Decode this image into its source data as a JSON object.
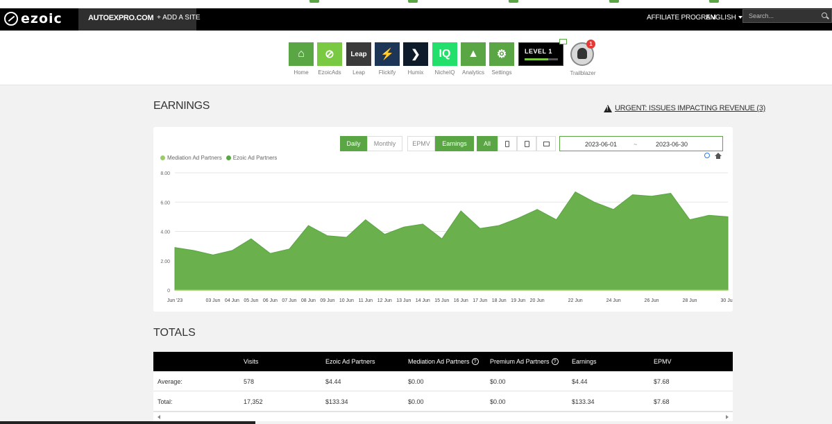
{
  "nav": {
    "site_name": "AUTOEXPRO.COM",
    "add_site": "+ ADD A SITE",
    "affiliate": "AFFILIATE PROGRAM",
    "language": "ENGLISH",
    "search_placeholder": "Search..."
  },
  "apps": [
    {
      "label": "Home",
      "glyph": "⌂",
      "color": "#5aa644"
    },
    {
      "label": "EzoicAds",
      "glyph": "⊘",
      "color": "#7ac943"
    },
    {
      "label": "Leap",
      "glyph": "Leap",
      "color": "#3a3a3a"
    },
    {
      "label": "Flickify",
      "glyph": "⚡",
      "color": "#1d3557"
    },
    {
      "label": "Humix",
      "glyph": "❯",
      "color": "#0d1b2a"
    },
    {
      "label": "NicheIQ",
      "glyph": "IQ",
      "color": "#22e06b"
    },
    {
      "label": "Analytics",
      "glyph": "▲",
      "color": "#5aa644"
    },
    {
      "label": "Settings",
      "glyph": "⚙",
      "color": "#5aa644"
    }
  ],
  "level": {
    "text": "LEVEL 1",
    "progress": 0.7
  },
  "trailblazer": {
    "label": "Trailblazer",
    "badge": "1"
  },
  "earnings": {
    "title": "EARNINGS",
    "urgent": "URGENT: ISSUES IMPACTING REVENUE (3)"
  },
  "controls": {
    "daily": "Daily",
    "monthly": "Monthly",
    "epmv": "EPMV",
    "earnings": "Earnings",
    "all": "All",
    "date_from": "2023-06-01",
    "date_sep": "~",
    "date_to": "2023-06-30"
  },
  "colors": {
    "accent": "#5aa644",
    "area": "#6ab04c",
    "mediation": "#9ccc65"
  },
  "chart_data": {
    "type": "area",
    "series": [
      {
        "name": "Mediation Ad Partners",
        "values": [
          0,
          0,
          0,
          0,
          0,
          0,
          0,
          0,
          0,
          0,
          0,
          0,
          0,
          0,
          0,
          0,
          0,
          0,
          0,
          0,
          0,
          0,
          0,
          0,
          0,
          0,
          0,
          0,
          0,
          0
        ]
      },
      {
        "name": "Ezoic Ad Partners",
        "values": [
          2.9,
          2.7,
          2.4,
          2.7,
          3.5,
          2.5,
          2.8,
          4.4,
          3.7,
          3.6,
          4.8,
          3.8,
          4.3,
          4.5,
          3.5,
          5.4,
          4.2,
          4.4,
          4.9,
          5.5,
          4.8,
          6.7,
          6.0,
          5.5,
          6.5,
          6.4,
          6.6,
          4.8,
          5.1,
          5.0
        ]
      }
    ],
    "x_tick_labels": [
      "Jun '23",
      "03 Jun",
      "04 Jun",
      "05 Jun",
      "06 Jun",
      "07 Jun",
      "08 Jun",
      "09 Jun",
      "10 Jun",
      "11 Jun",
      "12 Jun",
      "13 Jun",
      "14 Jun",
      "15 Jun",
      "16 Jun",
      "17 Jun",
      "18 Jun",
      "19 Jun",
      "20 Jun",
      "22 Jun",
      "24 Jun",
      "26 Jun",
      "28 Jun",
      "30 Jun"
    ],
    "x_tick_days": [
      1,
      3,
      4,
      5,
      6,
      7,
      8,
      9,
      10,
      11,
      12,
      13,
      14,
      15,
      16,
      17,
      18,
      19,
      20,
      22,
      24,
      26,
      28,
      30
    ],
    "y_ticks": [
      "0",
      "2.00",
      "4.00",
      "6.00",
      "8.00"
    ],
    "ylim": [
      0,
      8
    ],
    "grid": true,
    "legend": "top-left"
  },
  "totals": {
    "title": "TOTALS",
    "headers": [
      "",
      "Visits",
      "Ezoic Ad Partners",
      "Mediation Ad Partners",
      "Premium Ad Partners",
      "Earnings",
      "EPMV"
    ],
    "rows": [
      [
        "Average:",
        "578",
        "$4.44",
        "$0.00",
        "$0.00",
        "$4.44",
        "$7.68"
      ],
      [
        "Total:",
        "17,352",
        "$133.34",
        "$0.00",
        "$0.00",
        "$133.34",
        "$7.68"
      ]
    ]
  }
}
